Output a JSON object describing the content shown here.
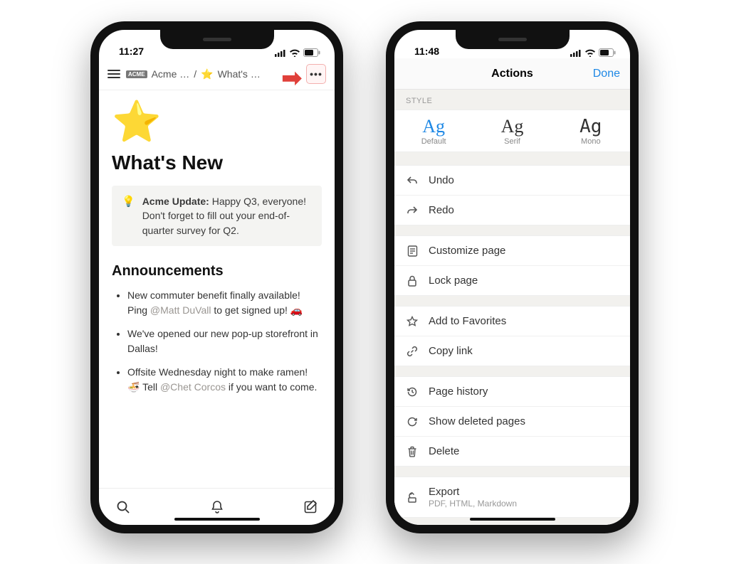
{
  "phone1": {
    "status_time": "11:27",
    "breadcrumb": {
      "workspace_badge": "ACME",
      "workspace": "Acme …",
      "separator": "/",
      "page_emoji": "⭐",
      "page": "What's …"
    },
    "page": {
      "emoji": "⭐",
      "title": "What's New",
      "callout": {
        "icon": "💡",
        "bold": "Acme Update:",
        "text": " Happy Q3, everyone! Don't forget to fill out your end-of-quarter survey for Q2."
      },
      "heading": "Announcements",
      "items": [
        {
          "pre": "New commuter benefit finally available! Ping ",
          "mention": "@Matt DuVall",
          "post": " to get signed up! 🚗"
        },
        {
          "pre": "We've opened our new pop-up storefront in Dallas!",
          "mention": "",
          "post": ""
        },
        {
          "pre": "Offsite Wednesday night to make ramen! 🍜 Tell ",
          "mention": "@Chet Corcos",
          "post": " if you want to come."
        }
      ]
    }
  },
  "phone2": {
    "status_time": "11:48",
    "sheet": {
      "title": "Actions",
      "done": "Done",
      "style_label": "STYLE",
      "styles": [
        {
          "sample": "Ag",
          "label": "Default"
        },
        {
          "sample": "Ag",
          "label": "Serif"
        },
        {
          "sample": "Ag",
          "label": "Mono"
        }
      ],
      "groups": [
        [
          {
            "icon": "undo",
            "label": "Undo"
          },
          {
            "icon": "redo",
            "label": "Redo"
          }
        ],
        [
          {
            "icon": "customize",
            "label": "Customize page"
          },
          {
            "icon": "lock",
            "label": "Lock page"
          }
        ],
        [
          {
            "icon": "star",
            "label": "Add to Favorites"
          },
          {
            "icon": "link",
            "label": "Copy link"
          }
        ],
        [
          {
            "icon": "history",
            "label": "Page history"
          },
          {
            "icon": "trash-restore",
            "label": "Show deleted pages"
          },
          {
            "icon": "trash",
            "label": "Delete"
          }
        ],
        [
          {
            "icon": "export",
            "label": "Export",
            "sub": "PDF, HTML, Markdown"
          }
        ]
      ]
    }
  }
}
